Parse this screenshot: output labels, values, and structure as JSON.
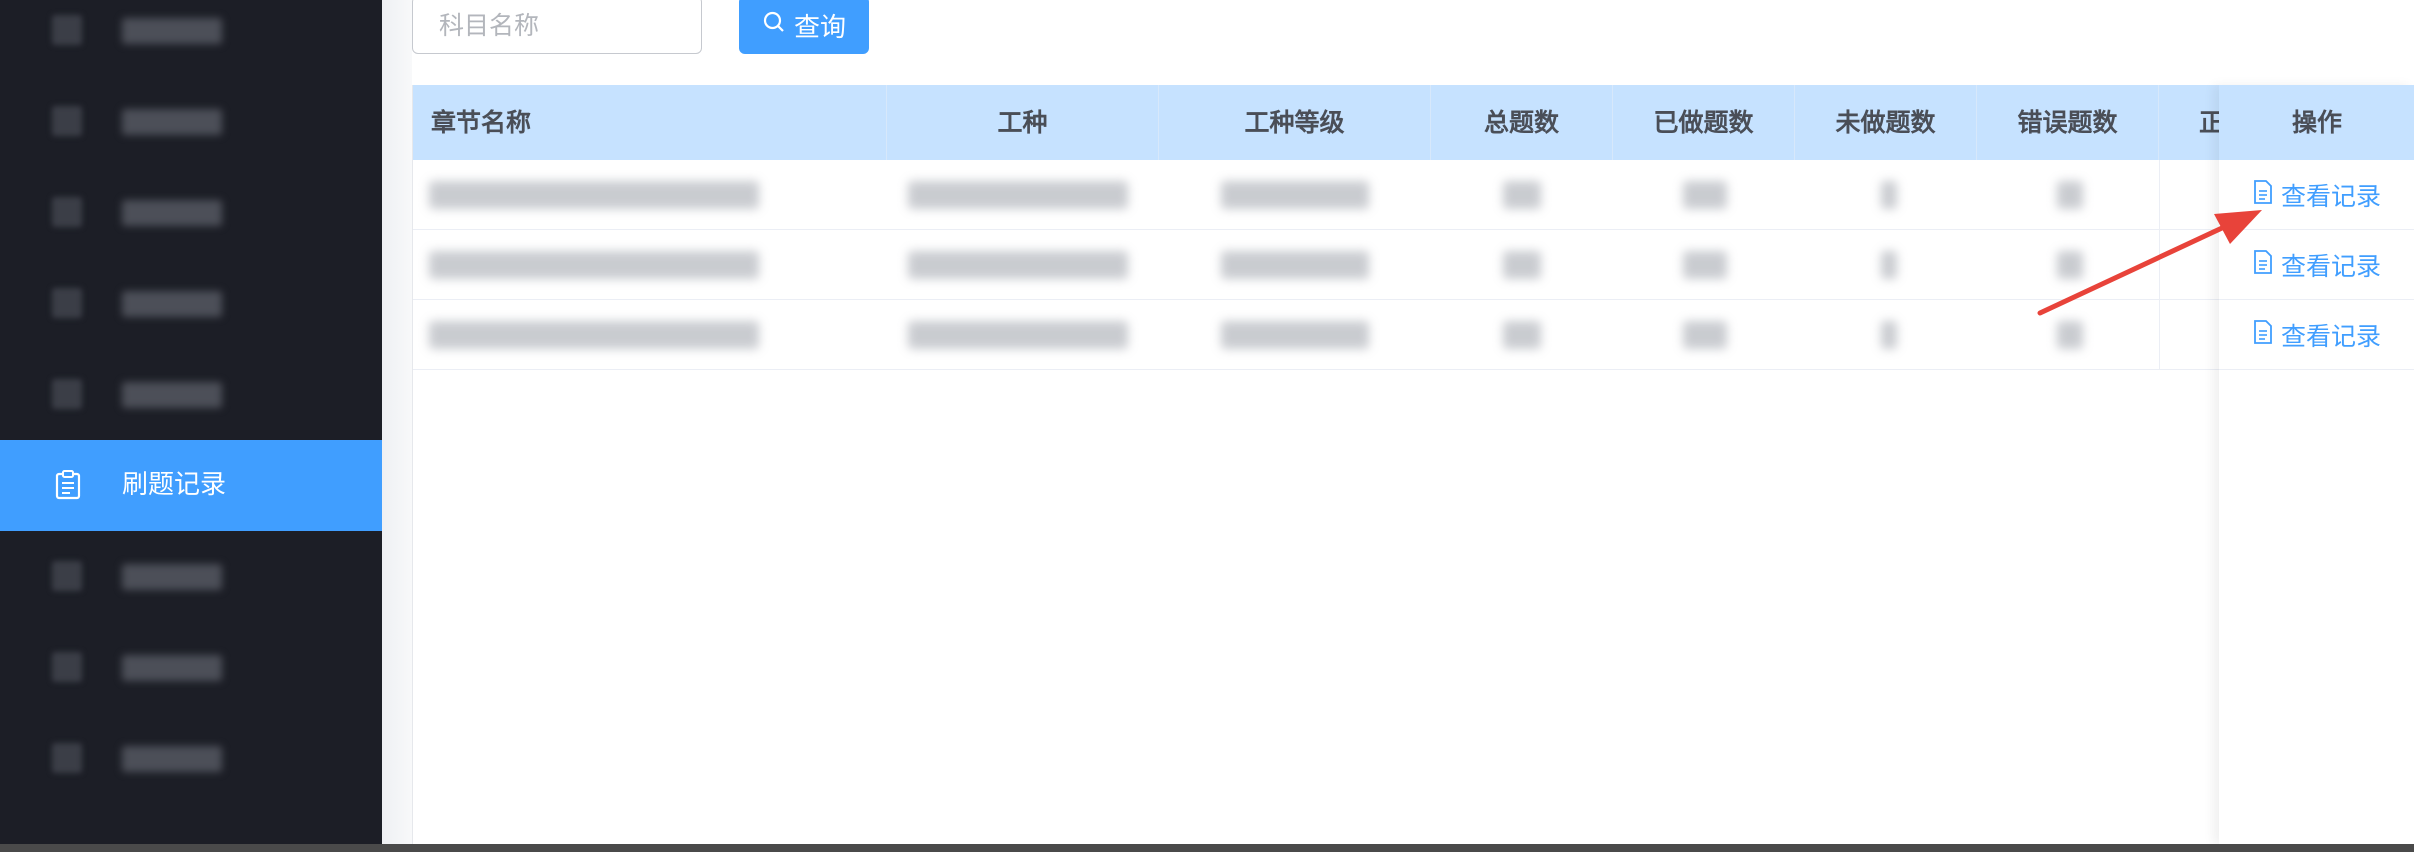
{
  "sidebar": {
    "active_item_label": "刷题记录",
    "active_item_icon": "clipboard-icon"
  },
  "search": {
    "placeholder": "科目名称",
    "button_label": "查询",
    "button_icon": "search-icon"
  },
  "table": {
    "columns": [
      "章节名称",
      "工种",
      "工种等级",
      "总题数",
      "已做题数",
      "未做题数",
      "错误题数",
      "正",
      "操作"
    ],
    "action_label": "查看记录",
    "action_icon": "document-icon",
    "row_count": 3
  },
  "colors": {
    "sidebar_bg": "#1c1e26",
    "accent": "#409eff",
    "table_header_bg": "#c6e2ff",
    "annotation_arrow": "#e8433a"
  }
}
